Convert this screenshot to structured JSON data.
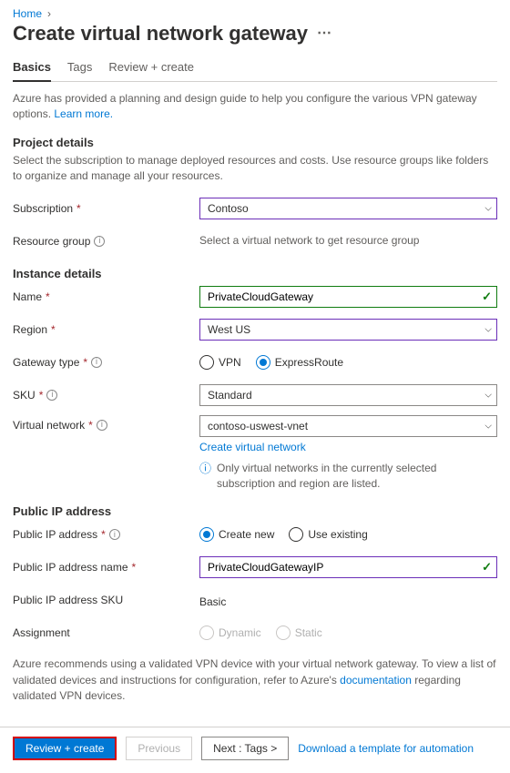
{
  "breadcrumb": {
    "home": "Home"
  },
  "title": "Create virtual network gateway",
  "tabs": {
    "basics": "Basics",
    "tags": "Tags",
    "review": "Review + create"
  },
  "intro": {
    "text": "Azure has provided a planning and design guide to help you configure the various VPN gateway options.  ",
    "learn_more": "Learn more."
  },
  "sections": {
    "project": {
      "heading": "Project details",
      "desc": "Select the subscription to manage deployed resources and costs. Use resource groups like folders to organize and manage all your resources."
    },
    "instance": {
      "heading": "Instance details"
    },
    "publicip": {
      "heading": "Public IP address"
    }
  },
  "fields": {
    "subscription": {
      "label": "Subscription",
      "value": "Contoso"
    },
    "resource_group": {
      "label": "Resource group",
      "helper": "Select a virtual network to get resource group"
    },
    "name": {
      "label": "Name",
      "value": "PrivateCloudGateway"
    },
    "region": {
      "label": "Region",
      "value": "West US"
    },
    "gateway_type": {
      "label": "Gateway type",
      "options": {
        "vpn": "VPN",
        "er": "ExpressRoute"
      }
    },
    "sku": {
      "label": "SKU",
      "value": "Standard"
    },
    "vnet": {
      "label": "Virtual network",
      "value": "contoso-uswest-vnet",
      "create_link": "Create virtual network",
      "info": "Only virtual networks in the currently selected subscription and region are listed."
    },
    "pip_mode": {
      "label": "Public IP address",
      "options": {
        "new": "Create new",
        "existing": "Use existing"
      }
    },
    "pip_name": {
      "label": "Public IP address name",
      "value": "PrivateCloudGatewayIP"
    },
    "pip_sku": {
      "label": "Public IP address SKU",
      "value": "Basic"
    },
    "assignment": {
      "label": "Assignment",
      "options": {
        "dynamic": "Dynamic",
        "static": "Static"
      }
    }
  },
  "footnote": {
    "pre": "Azure recommends using a validated VPN device with your virtual network gateway. To view a list of validated devices and instructions for configuration, refer to Azure's ",
    "link": "documentation",
    "post": " regarding validated VPN devices."
  },
  "footer": {
    "review": "Review + create",
    "previous": "Previous",
    "next": "Next : Tags >",
    "download": "Download a template for automation"
  }
}
